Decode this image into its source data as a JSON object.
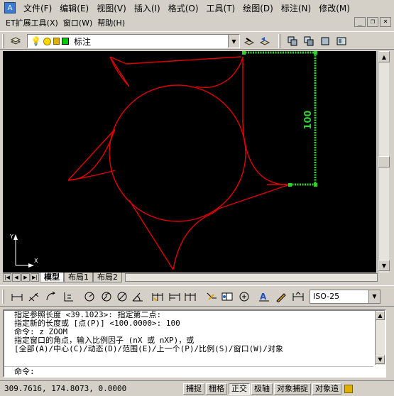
{
  "menu": {
    "row1": [
      "文件(F)",
      "编辑(E)",
      "视图(V)",
      "插入(I)",
      "格式(O)",
      "工具(T)",
      "绘图(D)",
      "标注(N)",
      "修改(M)"
    ],
    "row2": [
      "ET扩展工具(X)",
      "窗口(W)",
      "帮助(H)"
    ],
    "window_controls": [
      "_",
      "❐",
      "×"
    ]
  },
  "layer_toolbar": {
    "current_layer": "标注"
  },
  "canvas": {
    "dimension_text": "100",
    "ucs_y": "Y",
    "ucs_x": "X"
  },
  "tabs": {
    "nav_arrows": [
      "|◀",
      "◀",
      "▶",
      "▶|"
    ],
    "items": [
      "模型",
      "布局1",
      "布局2"
    ],
    "active": "模型"
  },
  "dim_toolbar": {
    "style_value": "ISO-25"
  },
  "command": {
    "history": [
      "指定参照长度 <39.1023>:  指定第二点:",
      "指定新的长度或 [点(P)] <100.0000>:  100",
      "命令: z ZOOM",
      "指定窗口的角点，输入比例因子 (nX 或 nXP)，或",
      "[全部(A)/中心(C)/动态(D)/范围(E)/上一个(P)/比例(S)/窗口(W)/对象"
    ],
    "prompt": "命令:"
  },
  "status": {
    "coordinates": "309.7616, 174.8073, 0.0000",
    "buttons": [
      {
        "label": "捕捉",
        "on": false
      },
      {
        "label": "栅格",
        "on": false
      },
      {
        "label": "正交",
        "on": true
      },
      {
        "label": "极轴",
        "on": false
      },
      {
        "label": "对象捕捉",
        "on": false
      },
      {
        "label": "对象追",
        "on": false
      }
    ]
  },
  "colors": {
    "drawing": "#e00000",
    "dimension": "#33cc33",
    "canvas_bg": "#000000"
  }
}
